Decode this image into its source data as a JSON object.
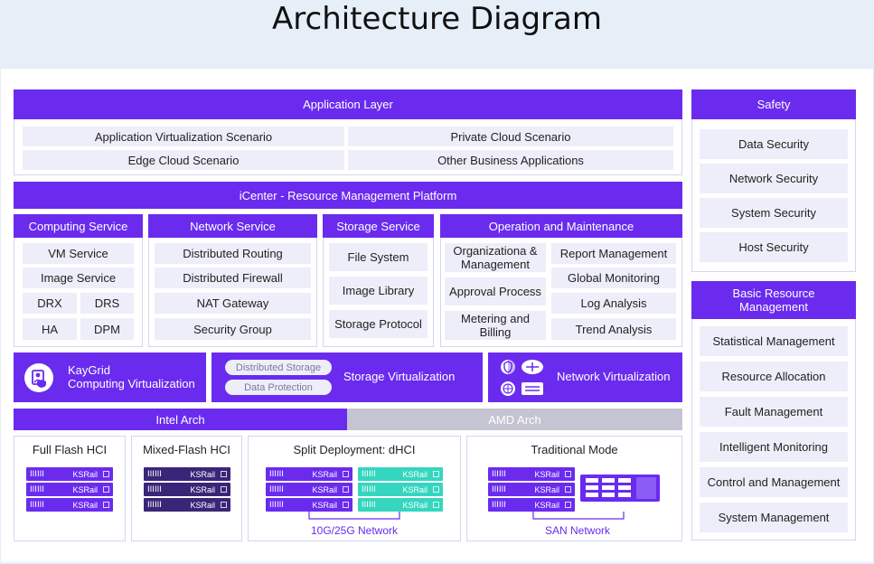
{
  "title": "Architecture Diagram",
  "application_layer": {
    "header": "Application Layer",
    "items": [
      "Application Virtualization Scenario",
      "Private Cloud Scenario",
      "Edge Cloud Scenario",
      "Other Business Applications"
    ]
  },
  "platform": "iCenter - Resource Management Platform",
  "computing": {
    "header": "Computing Service",
    "items": [
      "VM Service",
      "Image Service",
      "DRX",
      "DRS",
      "HA",
      "DPM"
    ]
  },
  "network": {
    "header": "Network Service",
    "items": [
      "Distributed Routing",
      "Distributed Firewall",
      "NAT Gateway",
      "Security Group"
    ]
  },
  "storage": {
    "header": "Storage Service",
    "items": [
      "File System",
      "Image Library",
      "Storage Protocol"
    ]
  },
  "operation": {
    "header": "Operation and Maintenance",
    "items": [
      "Organizationa & Management",
      "Report Management",
      "Approval Process",
      "Global Monitoring",
      "Log Analysis",
      "Metering and Billing",
      "Trend Analysis"
    ]
  },
  "virtualization": {
    "kaygrid": [
      "KayGrid",
      "Computing Virtualization"
    ],
    "storage_pills": [
      "Distributed Storage",
      "Data Protection"
    ],
    "storage_label": "Storage Virtualization",
    "network_label": "Network Virtualization"
  },
  "arch": {
    "intel": "Intel Arch",
    "amd": "AMD Arch"
  },
  "deploy": {
    "full_flash": "Full Flash HCI",
    "mixed_flash": "Mixed-Flash HCI",
    "split": "Split Deployment: dHCI",
    "traditional": "Traditional Mode",
    "server_label": "KSRail",
    "net_10g": "10G/25G Network",
    "san": "SAN Network"
  },
  "safety": {
    "header": "Safety",
    "items": [
      "Data Security",
      "Network Security",
      "System Security",
      "Host Security"
    ]
  },
  "basic": {
    "header": "Basic Resource Management",
    "items": [
      "Statistical Management",
      "Resource Allocation",
      "Fault Management",
      "Intelligent Monitoring",
      "Control and Management",
      "System Management"
    ]
  },
  "colors": {
    "primary": "#6a2bef",
    "amd": "#c4c4d2",
    "server_purple": "#6a2bef",
    "server_dark": "#3a2678",
    "server_teal": "#35d6bf",
    "cell_bg": "#eeeefa"
  },
  "icons": [
    "user-shield-icon",
    "security-shield-icon",
    "router-icon",
    "network-globe-icon",
    "switch-icon",
    "storage-array-icon"
  ]
}
